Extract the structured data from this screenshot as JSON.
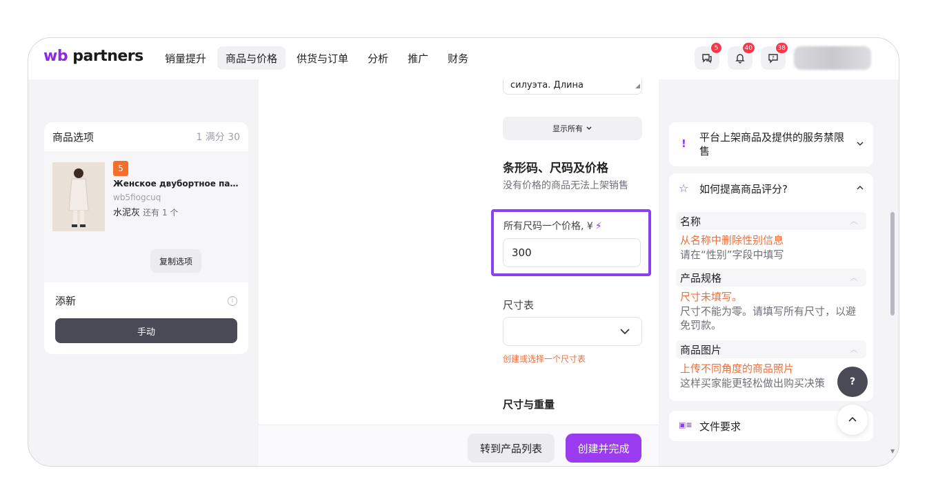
{
  "header": {
    "logo_wb": "wb",
    "logo_partners": "partners",
    "nav": [
      "销量提升",
      "商品与价格",
      "供货与订单",
      "分析",
      "推广",
      "财务"
    ],
    "badges": {
      "chat": "5",
      "bell": "40",
      "support": "38"
    }
  },
  "left_card": {
    "title": "商品选项",
    "count": "1 满分 30",
    "product": {
      "number": "5",
      "title": "Женское двубортное пальто...",
      "sku": "wb5fiogcuq",
      "color": "水泥灰",
      "more": "还有 1 个"
    },
    "copy_button": "复制选项",
    "add_new": "添新",
    "manual_button": "手动"
  },
  "middle": {
    "textarea_tail": "силуэта. Длина",
    "show_all": "显示所有",
    "section_title": "条形码、尺码及价格",
    "section_sub": "没有价格的商品无法上架销售",
    "price_label": "所有尺码一个价格, ¥",
    "price_value": "300",
    "size_table_label": "尺寸表",
    "size_table_hint": "创建或选择一个尺寸表",
    "size_weight_title": "尺寸与重量",
    "btn_list": "转到产品列表",
    "btn_create": "创建并完成"
  },
  "right": {
    "prohibited": "平台上架商品及提供的服务禁限售",
    "rating_title": "如何提高商品评分?",
    "items": [
      {
        "title": "名称",
        "error": "从名称中删除性别信息",
        "desc": "请在“性别”字段中填写"
      },
      {
        "title": "产品规格",
        "error": "尺寸未填写。",
        "desc": "尺寸不能为零。请填写所有尺寸，以避免罚款。"
      },
      {
        "title": "商品图片",
        "error": "上传不同角度的商品照片",
        "desc": "这样买家能更轻松做出购买决策"
      }
    ],
    "file_req": "文件要求",
    "help": "?"
  },
  "colors": {
    "accent": "#8b3ff0",
    "error": "#f26d3a",
    "badge": "#f5394b"
  }
}
